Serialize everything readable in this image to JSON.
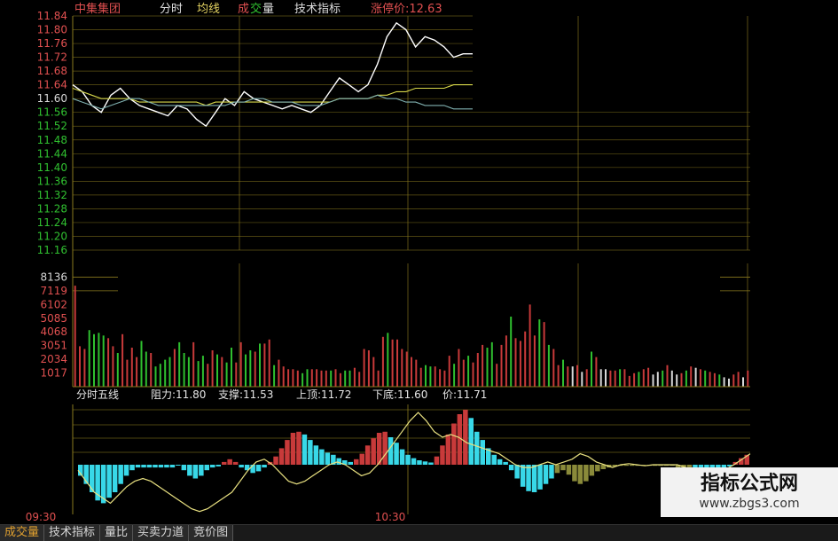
{
  "header": {
    "stock_name": "中集集团",
    "items": [
      "分时",
      "均线"
    ],
    "vol_prefix": "成",
    "vol_mid": "交",
    "vol_suffix": "量",
    "tech_label": "技术指标",
    "limit_up": "涨停价:12.63"
  },
  "colors": {
    "price_line": "#ffffff",
    "avg_line": "#d8d84a",
    "ma_line": "#7fb0b0",
    "up": "#c83a3a",
    "down": "#2fc02f",
    "flat": "#d8d8d8",
    "cyan": "#38d8e8",
    "olive": "#8a8a3a",
    "grid": "#8a7a1e",
    "tick_red": "#e05050",
    "tick_green": "#30c030",
    "tick_white": "#d8d8d8",
    "indicator_text": "#e6e6e6"
  },
  "time_labels": [
    "09:30",
    "10:30"
  ],
  "tabs": [
    "成交量",
    "技术指标",
    "量比",
    "买卖力道",
    "竞价图"
  ],
  "watermark": {
    "title": "指标公式网",
    "url": "www.zbgs3.com"
  },
  "chart_data": [
    {
      "type": "line",
      "name": "price_panel",
      "y_ticks": [
        "11.84",
        "11.80",
        "11.76",
        "11.72",
        "11.68",
        "11.64",
        "11.60",
        "11.56",
        "11.52",
        "11.48",
        "11.44",
        "11.40",
        "11.36",
        "11.32",
        "11.28",
        "11.24",
        "11.20",
        "11.16"
      ],
      "ylim": [
        11.16,
        11.84
      ],
      "series": [
        {
          "values": [
            11.64,
            11.62,
            11.58,
            11.56,
            11.61,
            11.63,
            11.6,
            11.58,
            11.57,
            11.56,
            11.55,
            11.58,
            11.57,
            11.54,
            11.52,
            11.56,
            11.6,
            11.58,
            11.62,
            11.6,
            11.59,
            11.58,
            11.57,
            11.58,
            11.57,
            11.56,
            11.58,
            11.62,
            11.66,
            11.64,
            11.62,
            11.64,
            11.7,
            11.78,
            11.82,
            11.8,
            11.75,
            11.78,
            11.77,
            11.75,
            11.72,
            11.73,
            11.73
          ]
        },
        {
          "values": [
            11.63,
            11.62,
            11.61,
            11.6,
            11.6,
            11.6,
            11.6,
            11.59,
            11.59,
            11.59,
            11.59,
            11.59,
            11.59,
            11.59,
            11.58,
            11.59,
            11.59,
            11.59,
            11.59,
            11.59,
            11.59,
            11.59,
            11.59,
            11.59,
            11.59,
            11.59,
            11.59,
            11.59,
            11.6,
            11.6,
            11.6,
            11.6,
            11.61,
            11.61,
            11.62,
            11.62,
            11.63,
            11.63,
            11.63,
            11.63,
            11.64,
            11.64,
            11.64
          ]
        },
        {
          "values": [
            11.6,
            11.59,
            11.58,
            11.57,
            11.58,
            11.59,
            11.6,
            11.6,
            11.59,
            11.58,
            11.58,
            11.58,
            11.58,
            11.58,
            11.58,
            11.58,
            11.58,
            11.59,
            11.59,
            11.6,
            11.6,
            11.59,
            11.59,
            11.59,
            11.58,
            11.58,
            11.58,
            11.59,
            11.6,
            11.6,
            11.6,
            11.6,
            11.61,
            11.6,
            11.6,
            11.59,
            11.59,
            11.58,
            11.58,
            11.58,
            11.57,
            11.57,
            11.57
          ]
        }
      ]
    },
    {
      "type": "bar",
      "name": "volume",
      "y_ticks": [
        "8136",
        "7119",
        "6102",
        "5085",
        "4068",
        "3051",
        "2034",
        "1017"
      ],
      "ylim": [
        0,
        9153
      ],
      "values": [
        7500,
        3000,
        2800,
        4200,
        3900,
        4000,
        3800,
        3600,
        3000,
        2500,
        3900,
        2000,
        2900,
        2200,
        3400,
        2600,
        2500,
        1500,
        1700,
        2000,
        2200,
        2800,
        3300,
        2500,
        2200,
        3300,
        1900,
        2300,
        1700,
        2700,
        2400,
        2200,
        1800,
        2900,
        1800,
        3300,
        2400,
        2700,
        2600,
        3200,
        3200,
        3500,
        1600,
        2000,
        1500,
        1300,
        1300,
        1200,
        1000,
        1300,
        1300,
        1300,
        1200,
        1200,
        1200,
        1300,
        1000,
        1200,
        1200,
        1400,
        1100,
        2800,
        2700,
        2200,
        1200,
        3700,
        4000,
        3500,
        3500,
        2800,
        2600,
        2200,
        2000,
        1400,
        1600,
        1500,
        1500,
        1300,
        1200,
        2300,
        1700,
        2800,
        2000,
        2300,
        1800,
        2500,
        3100,
        2900,
        3300,
        1700,
        3100,
        3800,
        5200,
        3600,
        3400,
        4100,
        6100,
        3800,
        5000,
        4800,
        3100,
        2800,
        1600,
        2000,
        1500,
        1500,
        1600,
        1100,
        1300,
        2600,
        2200,
        1300,
        1300,
        1200,
        1200,
        1300,
        1300,
        800,
        1000,
        1100,
        1300,
        1400,
        900,
        1100,
        1200,
        1600,
        1200,
        900,
        1000,
        1200,
        1500,
        1400,
        1300,
        1200,
        1100,
        1000,
        900,
        700,
        600,
        900,
        1100,
        700,
        1200
      ],
      "colors": [
        "u",
        "u",
        "u",
        "d",
        "d",
        "d",
        "d",
        "u",
        "u",
        "d",
        "u",
        "u",
        "u",
        "u",
        "d",
        "d",
        "u",
        "d",
        "d",
        "d",
        "d",
        "u",
        "d",
        "d",
        "d",
        "u",
        "d",
        "d",
        "u",
        "u",
        "d",
        "u",
        "d",
        "d",
        "u",
        "u",
        "d",
        "d",
        "u",
        "d",
        "u",
        "u",
        "d",
        "u",
        "u",
        "u",
        "u",
        "u",
        "d",
        "d",
        "u",
        "u",
        "u",
        "u",
        "d",
        "u",
        "u",
        "d",
        "d",
        "u",
        "u",
        "u",
        "u",
        "u",
        "u",
        "u",
        "d",
        "u",
        "u",
        "u",
        "u",
        "u",
        "u",
        "u",
        "d",
        "d",
        "u",
        "u",
        "u",
        "u",
        "d",
        "u",
        "u",
        "d",
        "u",
        "u",
        "u",
        "d",
        "d",
        "u",
        "u",
        "u",
        "d",
        "u",
        "u",
        "u",
        "u",
        "u",
        "d",
        "u",
        "d",
        "u",
        "u",
        "d",
        "u",
        "f",
        "u",
        "f",
        "u",
        "d",
        "u",
        "f",
        "f",
        "u",
        "u",
        "d",
        "u",
        "u",
        "u",
        "d",
        "u",
        "u",
        "f",
        "f",
        "d",
        "u",
        "f",
        "f",
        "u",
        "d",
        "u",
        "f",
        "u",
        "d",
        "u",
        "u",
        "d",
        "f",
        "f",
        "u",
        "u",
        "f",
        "u"
      ]
    },
    {
      "type": "bar",
      "name": "indicator",
      "labels": [
        "分时五线",
        "阻力:11.80",
        "支撑:11.53",
        "上顶:11.72",
        "下底:11.60",
        "价:11.71"
      ],
      "ylim": [
        -1,
        1
      ],
      "values": [
        -0.2,
        -0.35,
        -0.5,
        -0.65,
        -0.7,
        -0.6,
        -0.5,
        -0.35,
        -0.2,
        -0.1,
        -0.05,
        -0.05,
        -0.05,
        -0.05,
        -0.05,
        -0.05,
        -0.05,
        0.0,
        -0.1,
        -0.2,
        -0.25,
        -0.2,
        -0.1,
        -0.05,
        -0.03,
        0.05,
        0.1,
        0.05,
        -0.05,
        -0.1,
        -0.15,
        -0.12,
        -0.05,
        0.05,
        0.15,
        0.3,
        0.45,
        0.58,
        0.6,
        0.55,
        0.45,
        0.35,
        0.28,
        0.22,
        0.18,
        0.12,
        0.08,
        0.05,
        0.1,
        0.2,
        0.35,
        0.48,
        0.58,
        0.6,
        0.5,
        0.4,
        0.28,
        0.18,
        0.12,
        0.08,
        0.06,
        0.04,
        0.15,
        0.35,
        0.55,
        0.75,
        0.92,
        1.0,
        0.85,
        0.6,
        0.45,
        0.3,
        0.18,
        0.1,
        0.05,
        -0.1,
        -0.25,
        -0.4,
        -0.48,
        -0.5,
        -0.45,
        -0.35,
        -0.25,
        -0.15,
        -0.1,
        -0.18,
        -0.3,
        -0.35,
        -0.3,
        -0.2,
        -0.12,
        -0.08,
        -0.05,
        -0.03,
        -0.02,
        -0.02,
        -0.02,
        -0.02,
        -0.02,
        -0.02,
        -0.02,
        -0.02,
        -0.02,
        -0.02,
        -0.05,
        -0.1,
        -0.18,
        -0.25,
        -0.3,
        -0.28,
        -0.22,
        -0.15,
        -0.08,
        -0.03,
        0.05,
        0.12,
        0.18
      ],
      "colors": [
        "c",
        "c",
        "c",
        "c",
        "c",
        "c",
        "c",
        "c",
        "c",
        "c",
        "c",
        "c",
        "c",
        "c",
        "c",
        "c",
        "c",
        "c",
        "c",
        "c",
        "c",
        "c",
        "c",
        "c",
        "c",
        "r",
        "r",
        "r",
        "c",
        "c",
        "c",
        "c",
        "c",
        "r",
        "r",
        "r",
        "r",
        "r",
        "r",
        "c",
        "c",
        "c",
        "c",
        "c",
        "c",
        "c",
        "c",
        "c",
        "r",
        "r",
        "r",
        "r",
        "r",
        "r",
        "c",
        "c",
        "c",
        "c",
        "c",
        "c",
        "c",
        "c",
        "r",
        "r",
        "r",
        "r",
        "r",
        "r",
        "c",
        "c",
        "c",
        "c",
        "c",
        "c",
        "c",
        "c",
        "c",
        "c",
        "c",
        "c",
        "c",
        "c",
        "c",
        "o",
        "o",
        "o",
        "o",
        "o",
        "o",
        "o",
        "o",
        "o",
        "o",
        "o",
        "o",
        "o",
        "o",
        "o",
        "o",
        "o",
        "o",
        "o",
        "o",
        "o",
        "o",
        "o",
        "o",
        "c",
        "c",
        "c",
        "c",
        "c",
        "c",
        "c",
        "r",
        "r",
        "r",
        "r"
      ],
      "line": [
        -0.1,
        -0.3,
        -0.5,
        -0.6,
        -0.7,
        -0.55,
        -0.4,
        -0.3,
        -0.25,
        -0.3,
        -0.4,
        -0.5,
        -0.6,
        -0.7,
        -0.8,
        -0.85,
        -0.8,
        -0.7,
        -0.6,
        -0.5,
        -0.3,
        -0.1,
        0.05,
        0.1,
        0.0,
        -0.15,
        -0.3,
        -0.35,
        -0.3,
        -0.2,
        -0.1,
        0.0,
        0.05,
        0.0,
        -0.1,
        -0.2,
        -0.15,
        0.0,
        0.2,
        0.4,
        0.6,
        0.8,
        0.95,
        0.8,
        0.6,
        0.5,
        0.55,
        0.5,
        0.4,
        0.35,
        0.3,
        0.25,
        0.2,
        0.1,
        0.0,
        -0.05,
        -0.05,
        0.0,
        0.05,
        0.0,
        0.05,
        0.1,
        0.2,
        0.15,
        0.05,
        0.0,
        -0.05,
        0.0,
        0.02,
        0.0,
        -0.02,
        0.0,
        0.0,
        0.0,
        0.0,
        -0.05,
        -0.1,
        -0.15,
        -0.2,
        -0.15,
        -0.08,
        0.0,
        0.1,
        0.2
      ]
    }
  ]
}
